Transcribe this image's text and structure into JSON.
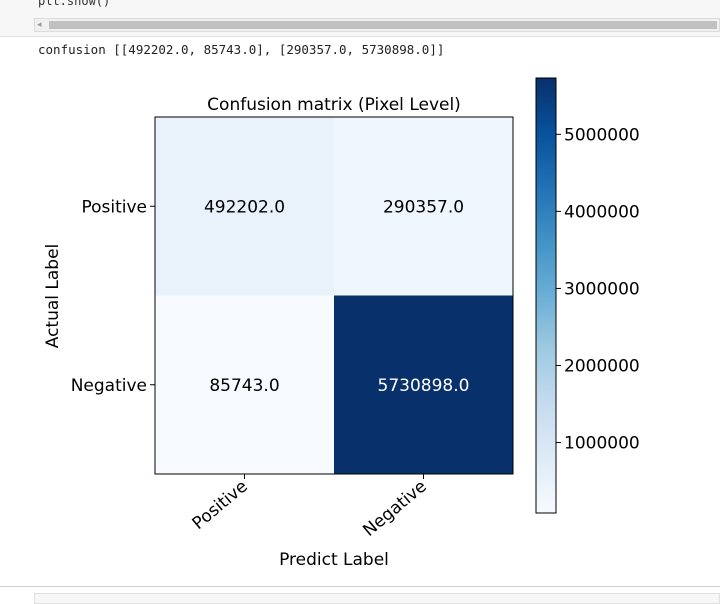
{
  "code_cell": {
    "code_line": "plt.show()"
  },
  "output": {
    "text": "confusion [[492202.0, 85743.0], [290357.0, 5730898.0]]"
  },
  "chart_data": {
    "type": "heatmap",
    "title": "Confusion matrix (Pixel Level)",
    "xlabel": "Predict Label",
    "ylabel": "Actual Label",
    "x_categories": [
      "Positive",
      "Negative"
    ],
    "y_categories": [
      "Positive",
      "Negative"
    ],
    "cells": [
      {
        "row": 0,
        "col": 0,
        "value": 492202.0,
        "label": "492202.0"
      },
      {
        "row": 0,
        "col": 1,
        "value": 290357.0,
        "label": "290357.0"
      },
      {
        "row": 1,
        "col": 0,
        "value": 85743.0,
        "label": "85743.0"
      },
      {
        "row": 1,
        "col": 1,
        "value": 5730898.0,
        "label": "5730898.0"
      }
    ],
    "colormap": "Blues",
    "colorbar": {
      "min": 85743.0,
      "max": 5730898.0,
      "ticks": [
        1000000,
        2000000,
        3000000,
        4000000,
        5000000
      ],
      "tick_labels": [
        "1000000",
        "2000000",
        "3000000",
        "4000000",
        "5000000"
      ]
    },
    "grid": false,
    "legend": "none"
  }
}
